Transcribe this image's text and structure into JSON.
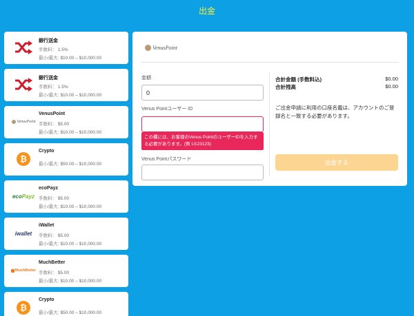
{
  "header": {
    "title": "出金"
  },
  "methods": [
    {
      "name": "銀行送金",
      "fee_label": "手数料：",
      "fee": "1.5%",
      "limits_label": "最小/最大:",
      "limits": "$10.00 – $10,000.00",
      "icon": "shuffle-icon"
    },
    {
      "name": "銀行送金",
      "fee_label": "手数料：",
      "fee": "1.5%",
      "limits_label": "最小/最大:",
      "limits": "$10.00 – $10,000.00",
      "icon": "shuffle-icon"
    },
    {
      "name": "VenusPoint",
      "fee_label": "手数料：",
      "fee": "$5.00",
      "limits_label": "最小/最大:",
      "limits": "$10.00 – $10,000.00",
      "logo_text": "VenusPoint"
    },
    {
      "name": "Crypto",
      "limits_label": "最小/最大:",
      "limits": "$50.00 – $10,000.00",
      "icon": "bitcoin-icon",
      "icon_glyph": "₿"
    },
    {
      "name": "ecoPayz",
      "fee_label": "手数料：",
      "fee": "$5.00",
      "limits_label": "最小/最大:",
      "limits": "$10.00 – $10,000.00",
      "logo_a": "eco",
      "logo_b": "Payz"
    },
    {
      "name": "iWallet",
      "fee_label": "手数料：",
      "fee": "$5.00",
      "limits_label": "最小/最大:",
      "limits": "$10.00 – $10,000.00",
      "logo_text": "iwallet"
    },
    {
      "name": "MuchBetter",
      "fee_label": "手数料：",
      "fee": "$5.00",
      "limits_label": "最小/最大:",
      "limits": "$10.00 – $10,000.00",
      "logo_text": "MuchBetter"
    },
    {
      "name": "Crypto",
      "limits_label": "最小/最大:",
      "limits": "$50.00 – $10,000.00",
      "icon": "bitcoin-icon",
      "icon_glyph": "₿"
    }
  ],
  "panel": {
    "logo_text": "VenusPoint",
    "amount_label": "金額",
    "amount_value": "0",
    "user_id_label": "Venus Pointユーザー ID",
    "user_id_value": "",
    "error_message": "この欄には、お客様のVenus PointのユーザーIDを入力する必要があります。(例 U123123)",
    "password_label": "Venus Pointパスワード",
    "password_value": "",
    "total_label": "合計金額 (手数料込)",
    "total_value": "$0.00",
    "balance_label": "合計残高",
    "balance_value": "$0.00",
    "note": "ご出金申請に利用の口座名義は、アカウントのご登録名と一致する必要があります。",
    "submit_label": "出金する"
  },
  "colors": {
    "background": "#0ea0e4",
    "title": "#ffee33",
    "error": "#e8285b",
    "submit": "#fbd591",
    "shuffle_icon": "#d01c2a",
    "bitcoin": "#f7931a"
  }
}
